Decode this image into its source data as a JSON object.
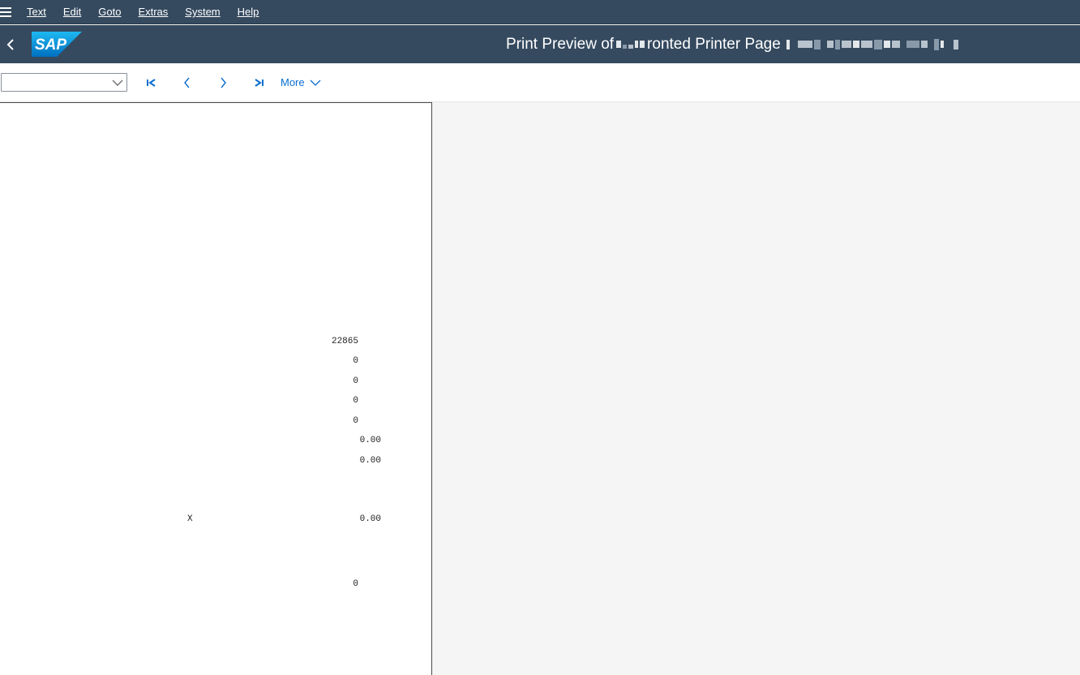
{
  "menubar": {
    "items": [
      {
        "label": "Text",
        "mnemonic": "T"
      },
      {
        "label": "Edit",
        "mnemonic": "E"
      },
      {
        "label": "Goto",
        "mnemonic": "G"
      },
      {
        "label": "Extras",
        "mnemonic": "a"
      },
      {
        "label": "System",
        "mnemonic": "y"
      },
      {
        "label": "Help",
        "mnemonic": "H"
      }
    ]
  },
  "shell": {
    "logo_text": "SAP",
    "title_part1": "Print Preview of",
    "title_part2": "ronted Printer Page"
  },
  "toolbar": {
    "select_value": "",
    "more_label": "More"
  },
  "preview": {
    "values": {
      "v1": "22865",
      "v2": "0",
      "v3": "0",
      "v4": "0",
      "v5": "0",
      "v6": "0.00",
      "v7": "0.00",
      "x_mark": "X",
      "v8": "0.00",
      "v9": "0"
    }
  },
  "colors": {
    "shell": "#354a5f",
    "accent": "#0a6ed1",
    "background": "#f5f5f5"
  }
}
